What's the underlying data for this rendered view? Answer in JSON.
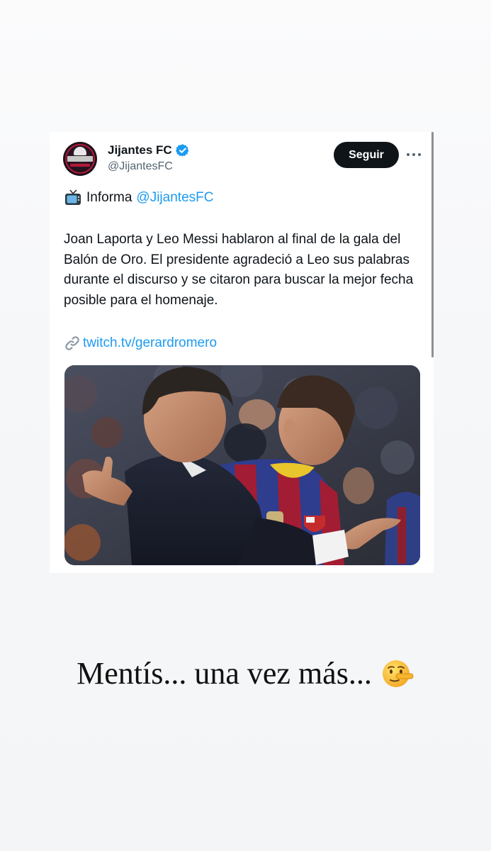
{
  "tweet": {
    "display_name": "Jijantes FC",
    "handle": "@JijantesFC",
    "follow_label": "Seguir",
    "informa_text": "Informa",
    "informa_mention": "@JijantesFC",
    "body": "Joan Laporta y Leo Messi hablaron al final de la gala del Balón de Oro. El presidente agradeció a Leo sus palabras  durante el discurso y se citaron para buscar la mejor fecha posible para el homenaje.",
    "link_text": "twitch.tv/gerardromero",
    "icons": {
      "avatar": "jijantes-logo",
      "verified": "verified-badge-icon",
      "more": "more-options-icon",
      "tv": "television-icon",
      "link": "link-icon"
    },
    "colors": {
      "link": "#1d9bf0",
      "verified": "#1d9bf0",
      "follow_bg": "#0f1419"
    }
  },
  "story": {
    "caption": "Mentís... una vez más...",
    "emoji": "lying-face-emoji"
  }
}
